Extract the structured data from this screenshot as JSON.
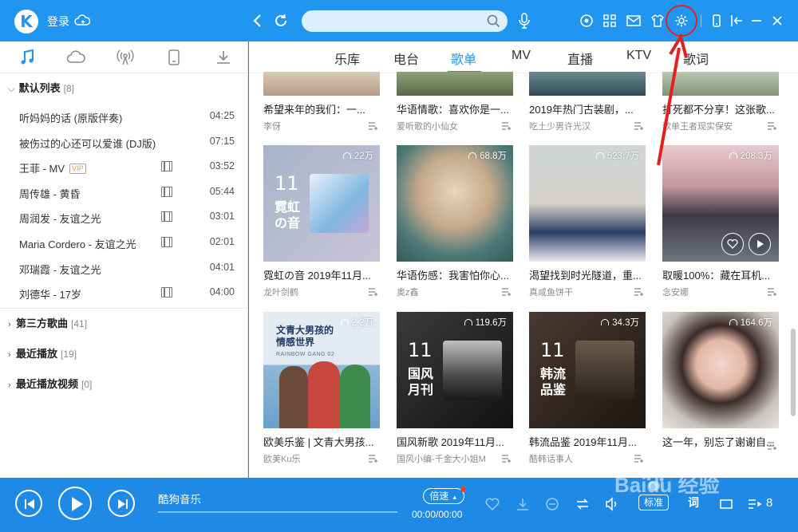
{
  "app": {
    "logo_letter": "K",
    "login_label": "登录"
  },
  "search": {
    "placeholder": ""
  },
  "toolbar_icons": [
    "target-icon",
    "apps-grid-icon",
    "mail-icon",
    "skin-shirt-icon",
    "settings-gear-icon",
    "phone-icon",
    "exit-icon",
    "minimize-icon",
    "close-icon"
  ],
  "sidebar": {
    "tab_icons": [
      "music-note-icon",
      "cloud-icon",
      "radio-icon",
      "device-icon",
      "download-icon"
    ],
    "groups": [
      {
        "name": "默认列表",
        "count": "[8]"
      },
      {
        "name": "第三方歌曲",
        "count": "[41]"
      },
      {
        "name": "最近播放",
        "count": "[19]"
      },
      {
        "name": "最近播放视频",
        "count": "[0]"
      }
    ],
    "songs": [
      {
        "title": "听妈妈的话 (原版伴奏)",
        "duration": "04:25"
      },
      {
        "title": "被伤过的心还可以爱谁 (DJ版)",
        "duration": "07:15"
      },
      {
        "title": "王菲 - MV",
        "duration": "03:52"
      },
      {
        "title": "周传雄 - 黄昏",
        "duration": "05:44"
      },
      {
        "title": "周润发 - 友谊之光",
        "duration": "03:01"
      },
      {
        "title": "Maria Cordero - 友谊之光",
        "duration": "02:01"
      },
      {
        "title": "邓瑞霞 - 友谊之光",
        "duration": "04:01"
      },
      {
        "title": "刘德华 - 17岁",
        "duration": "04:00"
      }
    ],
    "vip_badge": "VIP"
  },
  "main": {
    "tabs": [
      "乐库",
      "电台",
      "歌单",
      "MV",
      "直播",
      "KTV",
      "歌词"
    ],
    "active_tab": "歌单",
    "row1": [
      {
        "title": "希望来年的我们：一...",
        "author": "李伢"
      },
      {
        "title": "华语情歌：喜欢你是一...",
        "author": "爱听歌的小仙女"
      },
      {
        "title": "2019年热门古装剧，...",
        "author": "吃土少男许光汉"
      },
      {
        "title": "打死都不分享！这张歌...",
        "author": "歌单王者现实保安"
      }
    ],
    "row2": [
      {
        "title": "霓虹の音 2019年11月...",
        "author": "龙叶剑鹤",
        "plays": "22万",
        "cover_num": "11",
        "cover_text": [
          "霓虹",
          "の音"
        ]
      },
      {
        "title": "华语伤感：我害怕你心...",
        "author": "奥z鑫",
        "plays": "68.8万"
      },
      {
        "title": "渴望找到时光隧道，重...",
        "author": "真咸鱼饼干",
        "plays": "523.7万"
      },
      {
        "title": "取暖100%：藏在耳机...",
        "author": "念安娜",
        "plays": "208.3万"
      }
    ],
    "row3": [
      {
        "title": "欧美乐鉴 | 文青大男孩...",
        "author": "欧美Ku乐",
        "plays": "2.2万",
        "poster_lines": [
          "文青大男孩的",
          "情感世界"
        ],
        "poster_sub": "RAINBOW GANG 02"
      },
      {
        "title": "国风新歌 2019年11月...",
        "author": "国风小编-千金大小姐M",
        "plays": "119.6万",
        "cover_num": "11",
        "cover_text": [
          "国风",
          "月刊"
        ]
      },
      {
        "title": "韩流品鉴 2019年11月...",
        "author": "酷韩话事人",
        "plays": "34.3万",
        "cover_num": "11",
        "cover_text": [
          "韩流",
          "品鉴"
        ]
      },
      {
        "title": "这一年，别忘了谢谢自...",
        "author": "",
        "plays": "164.6万"
      }
    ]
  },
  "player": {
    "track_title": "酷狗音乐",
    "speed_label": "倍速",
    "time": "00:00/00:00",
    "quality_label": "标准",
    "lyric_label": "词",
    "playlist_count": "8"
  },
  "watermark": {
    "text": "Baidu 经验"
  },
  "colors": {
    "brand": "#2196f0",
    "player_bg": "#1f8ae6",
    "annotation": "#e0211f"
  }
}
